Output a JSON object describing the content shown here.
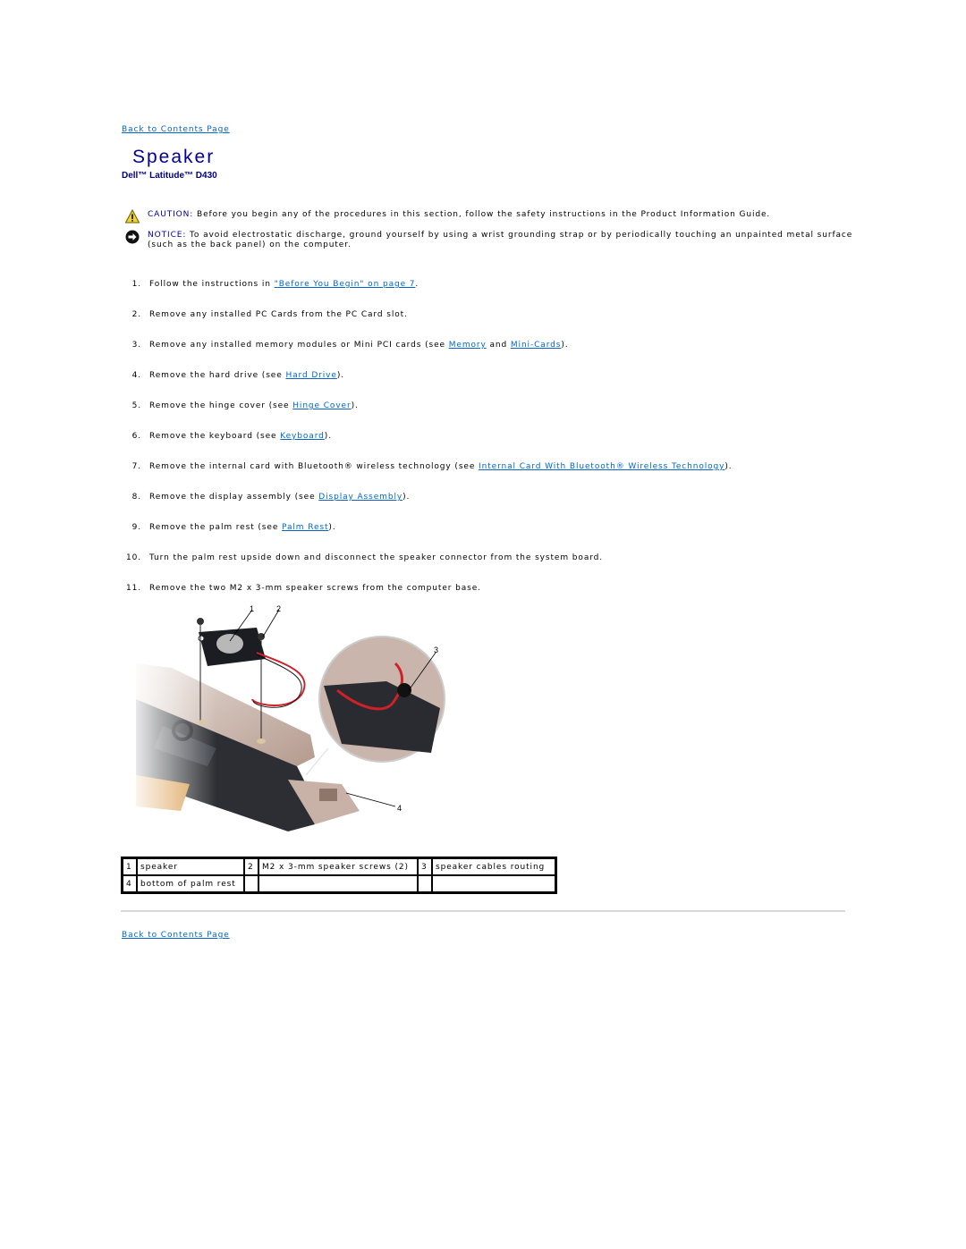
{
  "nav": {
    "back_to_contents": "Back to Contents Page"
  },
  "page": {
    "title": "Speaker",
    "subtitle": "Dell™ Latitude™ D430"
  },
  "caution": {
    "icon": "warning-triangle-icon",
    "label": "CAUTION:",
    "text": " Before you begin any of the procedures in this section, follow the safety instructions in the Product Information Guide."
  },
  "notice": {
    "icon": "notice-arrow-circle-icon",
    "label": "NOTICE:",
    "text": " To avoid electrostatic discharge, ground yourself by using a wrist grounding strap or by periodically touching an unpainted metal surface (such as the back panel) on the computer."
  },
  "steps": [
    {
      "num": "1.",
      "pre": "Follow the instructions in ",
      "link": "\"Before You Begin\" on page 7",
      "post": "."
    },
    {
      "num": "2.",
      "pre": "Remove any installed PC Cards from the PC Card slot."
    },
    {
      "num": "3.",
      "pre": "Remove any installed memory modules or Mini PCI cards (see ",
      "link": "Memory",
      "mid": " and ",
      "link2": "Mini-Cards",
      "post": ")."
    },
    {
      "num": "4.",
      "pre": "Remove the hard drive (see ",
      "link": "Hard Drive",
      "post": ")."
    },
    {
      "num": "5.",
      "pre": "Remove the hinge cover (see ",
      "link": "Hinge Cover",
      "post": ")."
    },
    {
      "num": "6.",
      "pre": "Remove the keyboard (see ",
      "link": "Keyboard",
      "post": ")."
    },
    {
      "num": "7.",
      "pre": "Remove the internal card with Bluetooth® wireless technology (see ",
      "link": "Internal Card With Bluetooth® Wireless Technology",
      "post": ")."
    },
    {
      "num": "8.",
      "pre": "Remove the display assembly (see ",
      "link": "Display Assembly",
      "post": ")."
    },
    {
      "num": "9.",
      "pre": "Remove the palm rest (see ",
      "link": "Palm Rest",
      "post": ")."
    },
    {
      "num": "10.",
      "pre": "Turn the palm rest upside down and disconnect the speaker connector from the system board."
    },
    {
      "num": "11.",
      "pre": "Remove the two M2 x 3-mm speaker screws from the computer base."
    }
  ],
  "figure": {
    "callouts": [
      "1",
      "2",
      "3",
      "4"
    ]
  },
  "legend": {
    "rows": [
      [
        {
          "n": "1",
          "label": "speaker"
        },
        {
          "n": "2",
          "label": "M2 x 3-mm speaker screws (2)"
        },
        {
          "n": "3",
          "label": "speaker cables routing"
        }
      ],
      [
        {
          "n": "4",
          "label": "bottom of palm rest"
        },
        {
          "n": "",
          "label": ""
        },
        {
          "n": "",
          "label": ""
        }
      ]
    ]
  }
}
